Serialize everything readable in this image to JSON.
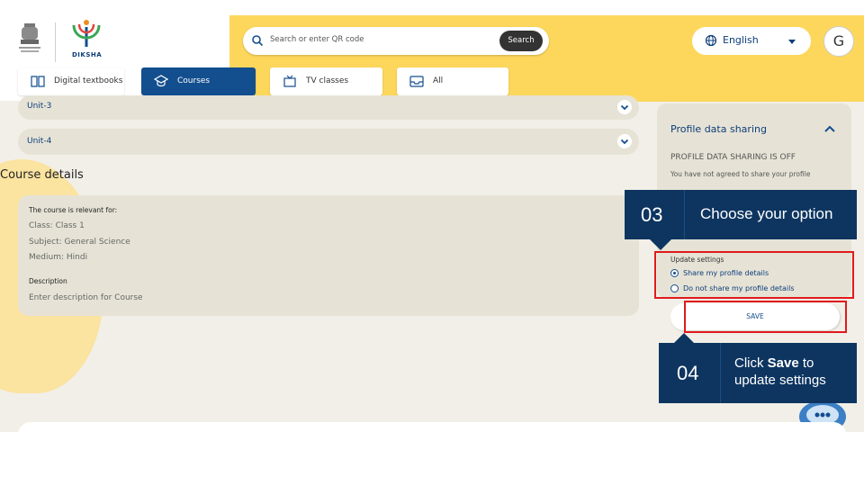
{
  "header": {
    "logo_text": "DIKSHA",
    "search": {
      "placeholder": "Search or enter QR code",
      "button": "Search"
    },
    "language": "English",
    "avatar_letter": "G"
  },
  "tabs": [
    {
      "label": "Digital textbooks",
      "icon": "book-icon"
    },
    {
      "label": "Courses",
      "icon": "graduation-cap-icon",
      "active": true
    },
    {
      "label": "TV classes",
      "icon": "tv-icon"
    },
    {
      "label": "All",
      "icon": "inbox-icon"
    }
  ],
  "units": [
    "Unit-3",
    "Unit-4"
  ],
  "course_details": {
    "title": "Course details",
    "relevant_label": "The course is relevant for:",
    "class": "Class: Class 1",
    "subject": "Subject: General Science",
    "medium": "Medium: Hindi",
    "description_label": "Description",
    "description": "Enter description for Course"
  },
  "profile_sharing": {
    "title": "Profile data sharing",
    "status": "PROFILE DATA SHARING IS OFF",
    "desc": "You have not agreed to share your profile",
    "update_label": "Update settings",
    "options": [
      "Share my profile details",
      "Do not share my profile details"
    ],
    "selected_option": 0,
    "save": "SAVE"
  },
  "callouts": [
    {
      "number": "03",
      "text": "Choose your option"
    },
    {
      "number": "04",
      "text_before": "Click ",
      "text_bold": "Save",
      "text_after": " to update settings"
    }
  ],
  "colors": {
    "brand_yellow": "#fdd75c",
    "brand_blue": "#134e8e",
    "callout_bg": "#0d3560",
    "highlight_red": "#e01b1b",
    "page_bg": "#f1efe7"
  }
}
